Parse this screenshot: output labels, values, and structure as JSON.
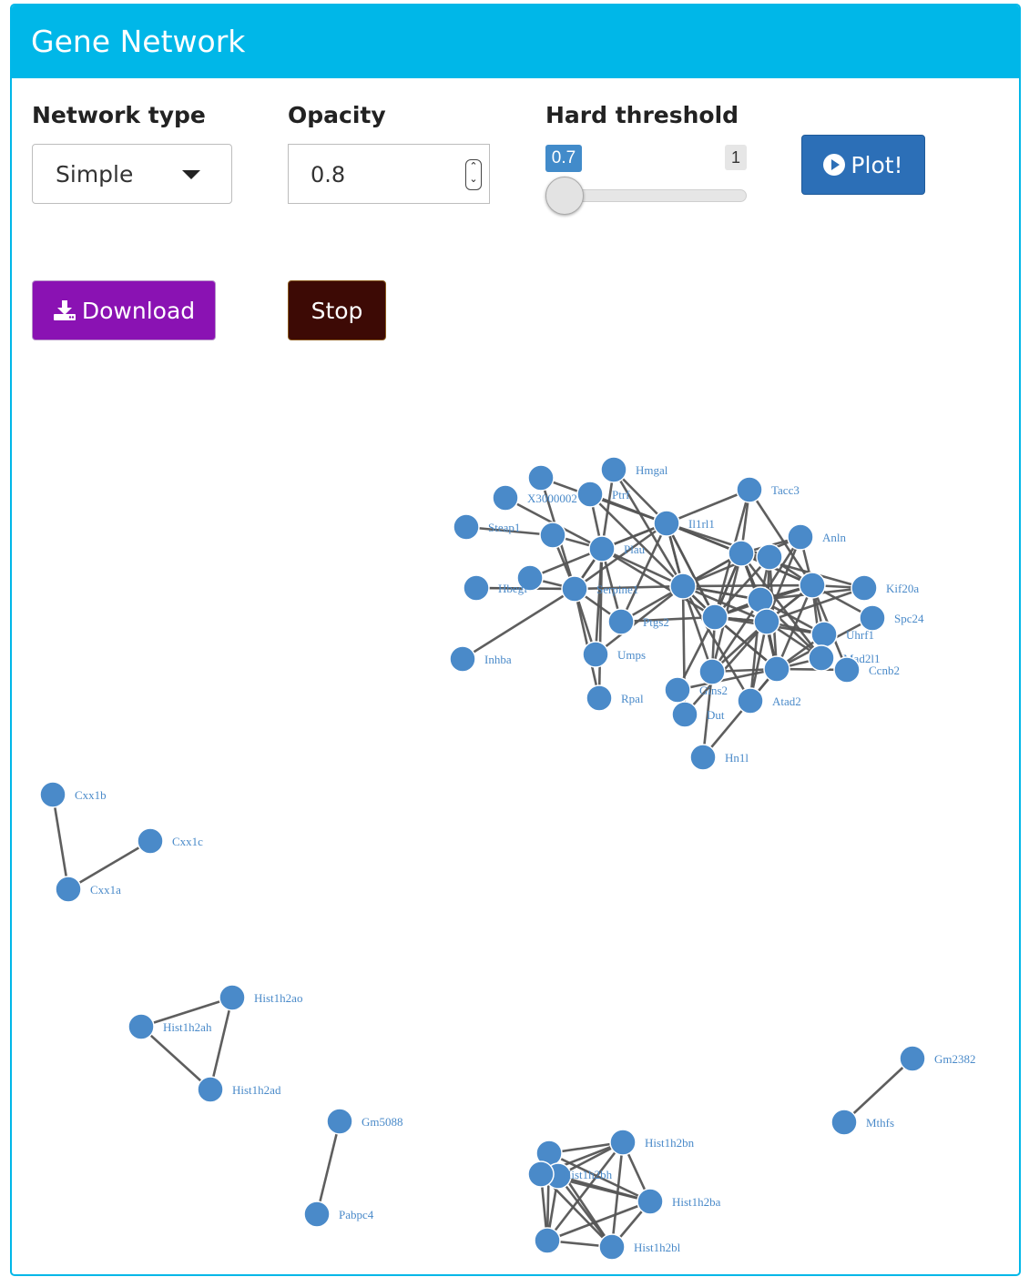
{
  "panel": {
    "title": "Gene Network"
  },
  "controls": {
    "network_type": {
      "label": "Network type",
      "value": "Simple"
    },
    "opacity": {
      "label": "Opacity",
      "value": "0.8"
    },
    "hard_threshold": {
      "label": "Hard threshold",
      "value_label": "0.7",
      "max_label": "1",
      "value": 0.7,
      "min": 0.7,
      "max": 1
    },
    "plot_label": "Plot!",
    "download_label": "Download",
    "stop_label": "Stop"
  },
  "colors": {
    "header": "#00b7e8",
    "node": "#4a8ac9",
    "edge": "#555555",
    "plot_button": "#2c6fb7",
    "download_button": "#8a12b3",
    "stop_button": "#3d0a05"
  },
  "network": {
    "nodes": [
      {
        "id": "Hmgal",
        "label": "Hmgal"
      },
      {
        "id": "Tacc3",
        "label": "Tacc3"
      },
      {
        "id": "Anln",
        "label": "Anln"
      },
      {
        "id": "Il1rl1",
        "label": "Il1rl1"
      },
      {
        "id": "Steap1",
        "label": "Steap1"
      },
      {
        "id": "Hbegf",
        "label": "Hbegf"
      },
      {
        "id": "Kif20a",
        "label": "Kif20a"
      },
      {
        "id": "Spc24",
        "label": "Spc24"
      },
      {
        "id": "Inhba",
        "label": "Inhba"
      },
      {
        "id": "Uhrf1",
        "label": "Uhrf1"
      },
      {
        "id": "Mad2l1",
        "label": "Mad2l1"
      },
      {
        "id": "Ccnb2",
        "label": "Ccnb2"
      },
      {
        "id": "Umps",
        "label": "Umps"
      },
      {
        "id": "Rpal",
        "label": "Rpal"
      },
      {
        "id": "Atad2",
        "label": "Atad2"
      },
      {
        "id": "Gins2",
        "label": "Gins2"
      },
      {
        "id": "Dut",
        "label": "Dut"
      },
      {
        "id": "Hn1l",
        "label": "Hn1l"
      },
      {
        "id": "X3000002",
        "label": "X3000002"
      },
      {
        "id": "Plau",
        "label": "Plau"
      },
      {
        "id": "Ptrf",
        "label": "Ptrf"
      },
      {
        "id": "Ptgs2",
        "label": "Ptgs2"
      },
      {
        "id": "Serpine1",
        "label": "Serpine1"
      },
      {
        "id": "Cxx1b",
        "label": "Cxx1b"
      },
      {
        "id": "Cxx1c",
        "label": "Cxx1c"
      },
      {
        "id": "Cxx1a",
        "label": "Cxx1a"
      },
      {
        "id": "Hist1h2ao",
        "label": "Hist1h2ao"
      },
      {
        "id": "Hist1h2ah",
        "label": "Hist1h2ah"
      },
      {
        "id": "Hist1h2ad",
        "label": "Hist1h2ad"
      },
      {
        "id": "Gm5088",
        "label": "Gm5088"
      },
      {
        "id": "Pabpc4",
        "label": "Pabpc4"
      },
      {
        "id": "Hist1h2bn",
        "label": "Hist1h2bn"
      },
      {
        "id": "Hist1h2bh",
        "label": "Hist1h2bh"
      },
      {
        "id": "Hist1h2ba",
        "label": "Hist1h2ba"
      },
      {
        "id": "Hist1h2bl",
        "label": "Hist1h2bl"
      },
      {
        "id": "Gm2382",
        "label": "Gm2382"
      },
      {
        "id": "Mthfs",
        "label": "Mthfs"
      }
    ],
    "edges": [
      [
        "Cxx1b",
        "Cxx1a"
      ],
      [
        "Cxx1a",
        "Cxx1c"
      ],
      [
        "Hist1h2ah",
        "Hist1h2ao"
      ],
      [
        "Hist1h2ah",
        "Hist1h2ad"
      ],
      [
        "Hist1h2ao",
        "Hist1h2ad"
      ],
      [
        "Gm5088",
        "Pabpc4"
      ],
      [
        "Gm2382",
        "Mthfs"
      ]
    ]
  }
}
